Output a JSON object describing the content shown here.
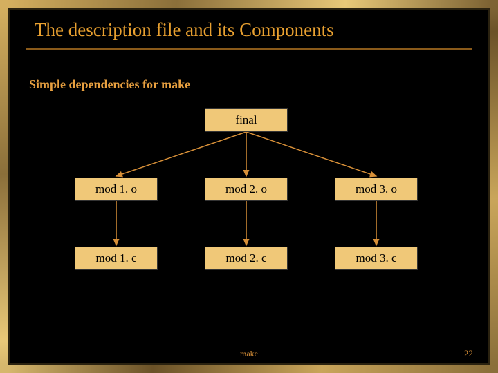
{
  "title": "The description file and its Components",
  "subtitle": "Simple dependencies for make",
  "nodes": {
    "final": "final",
    "mod1o": "mod 1. o",
    "mod2o": "mod 2. o",
    "mod3o": "mod 3. o",
    "mod1c": "mod 1. c",
    "mod2c": "mod 2. c",
    "mod3c": "mod 3. c"
  },
  "footer": {
    "name": "make",
    "page": "22"
  },
  "colors": {
    "accent": "#e8a030",
    "node_bg": "#f0c878",
    "line": "#d89038"
  }
}
